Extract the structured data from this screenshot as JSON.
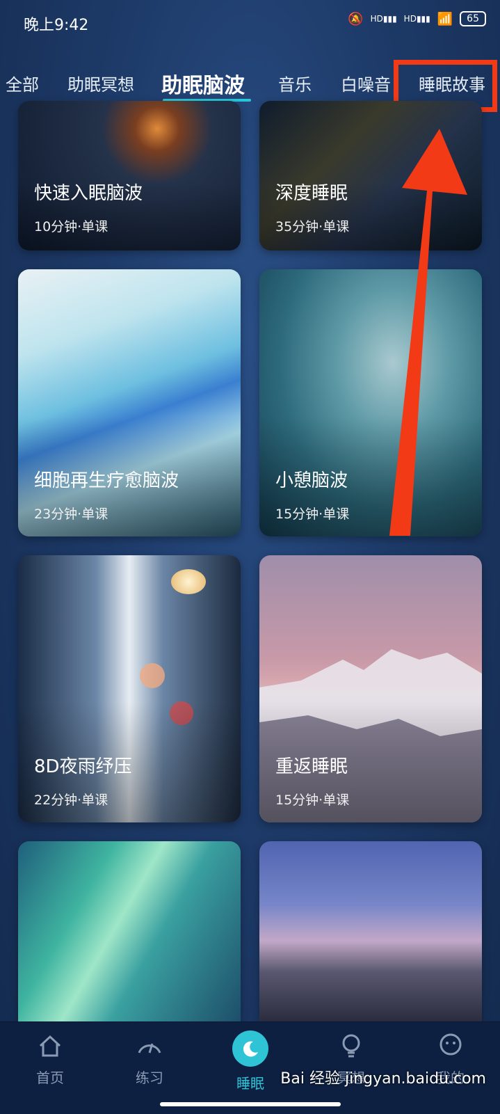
{
  "status": {
    "time": "晚上9:42",
    "signal1": "HD",
    "signal2": "HD",
    "battery": "65"
  },
  "tabs": [
    {
      "label": "全部"
    },
    {
      "label": "助眠冥想"
    },
    {
      "label": "助眠脑波"
    },
    {
      "label": "音乐"
    },
    {
      "label": "白噪音"
    },
    {
      "label": "睡眠故事"
    }
  ],
  "cards": [
    {
      "title": "快速入眠脑波",
      "meta": "10分钟·单课"
    },
    {
      "title": "深度睡眠",
      "meta": "35分钟·单课"
    },
    {
      "title": "细胞再生疗愈脑波",
      "meta": "23分钟·单课"
    },
    {
      "title": "小憩脑波",
      "meta": "15分钟·单课"
    },
    {
      "title": "8D夜雨纾压",
      "meta": "22分钟·单课"
    },
    {
      "title": "重返睡眠",
      "meta": "15分钟·单课"
    }
  ],
  "nav": [
    {
      "label": "首页",
      "icon": "home-icon"
    },
    {
      "label": "练习",
      "icon": "gauge-icon"
    },
    {
      "label": "睡眠",
      "icon": "moon-icon"
    },
    {
      "label": "冥想",
      "icon": "bulb-icon"
    },
    {
      "label": "我的",
      "icon": "user-icon"
    }
  ],
  "watermark": "Bai  经验  jingyan.baidu.com",
  "colors": {
    "accent": "#2fc3d6",
    "highlight": "#f23a17"
  }
}
